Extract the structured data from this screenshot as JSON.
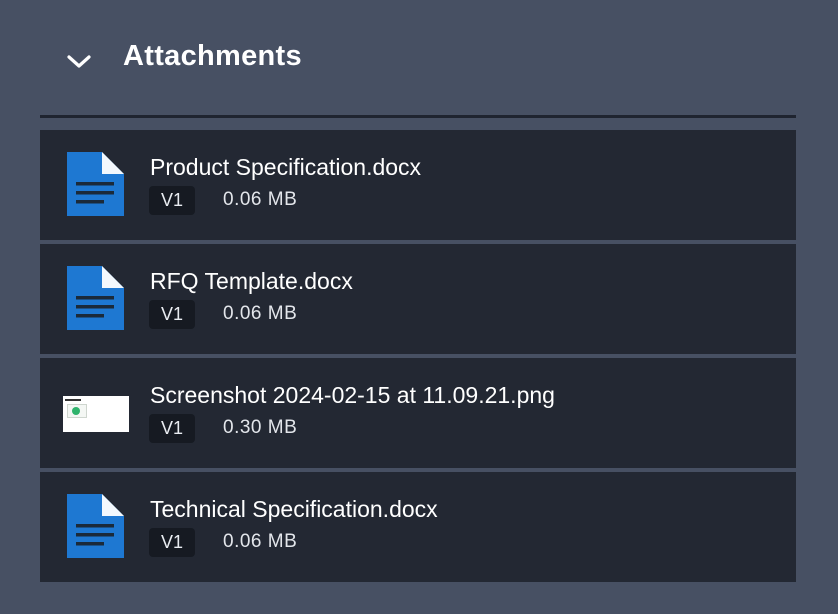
{
  "section": {
    "title": "Attachments",
    "toggle_icon": "chevron-down-icon"
  },
  "colors": {
    "background": "#475063",
    "row_background": "#232833",
    "doc_icon_blue": "#1e78d2",
    "badge_background": "#161a22"
  },
  "attachments": [
    {
      "name": "Product Specification.docx",
      "version": "V1",
      "size": "0.06 MB",
      "icon": "word-document-icon"
    },
    {
      "name": "RFQ Template.docx",
      "version": "V1",
      "size": "0.06 MB",
      "icon": "word-document-icon"
    },
    {
      "name": "Screenshot 2024-02-15 at 11.09.21.png",
      "version": "V1",
      "size": "0.30 MB",
      "icon": "image-thumbnail"
    },
    {
      "name": "Technical Specification.docx",
      "version": "V1",
      "size": "0.06 MB",
      "icon": "word-document-icon"
    }
  ]
}
